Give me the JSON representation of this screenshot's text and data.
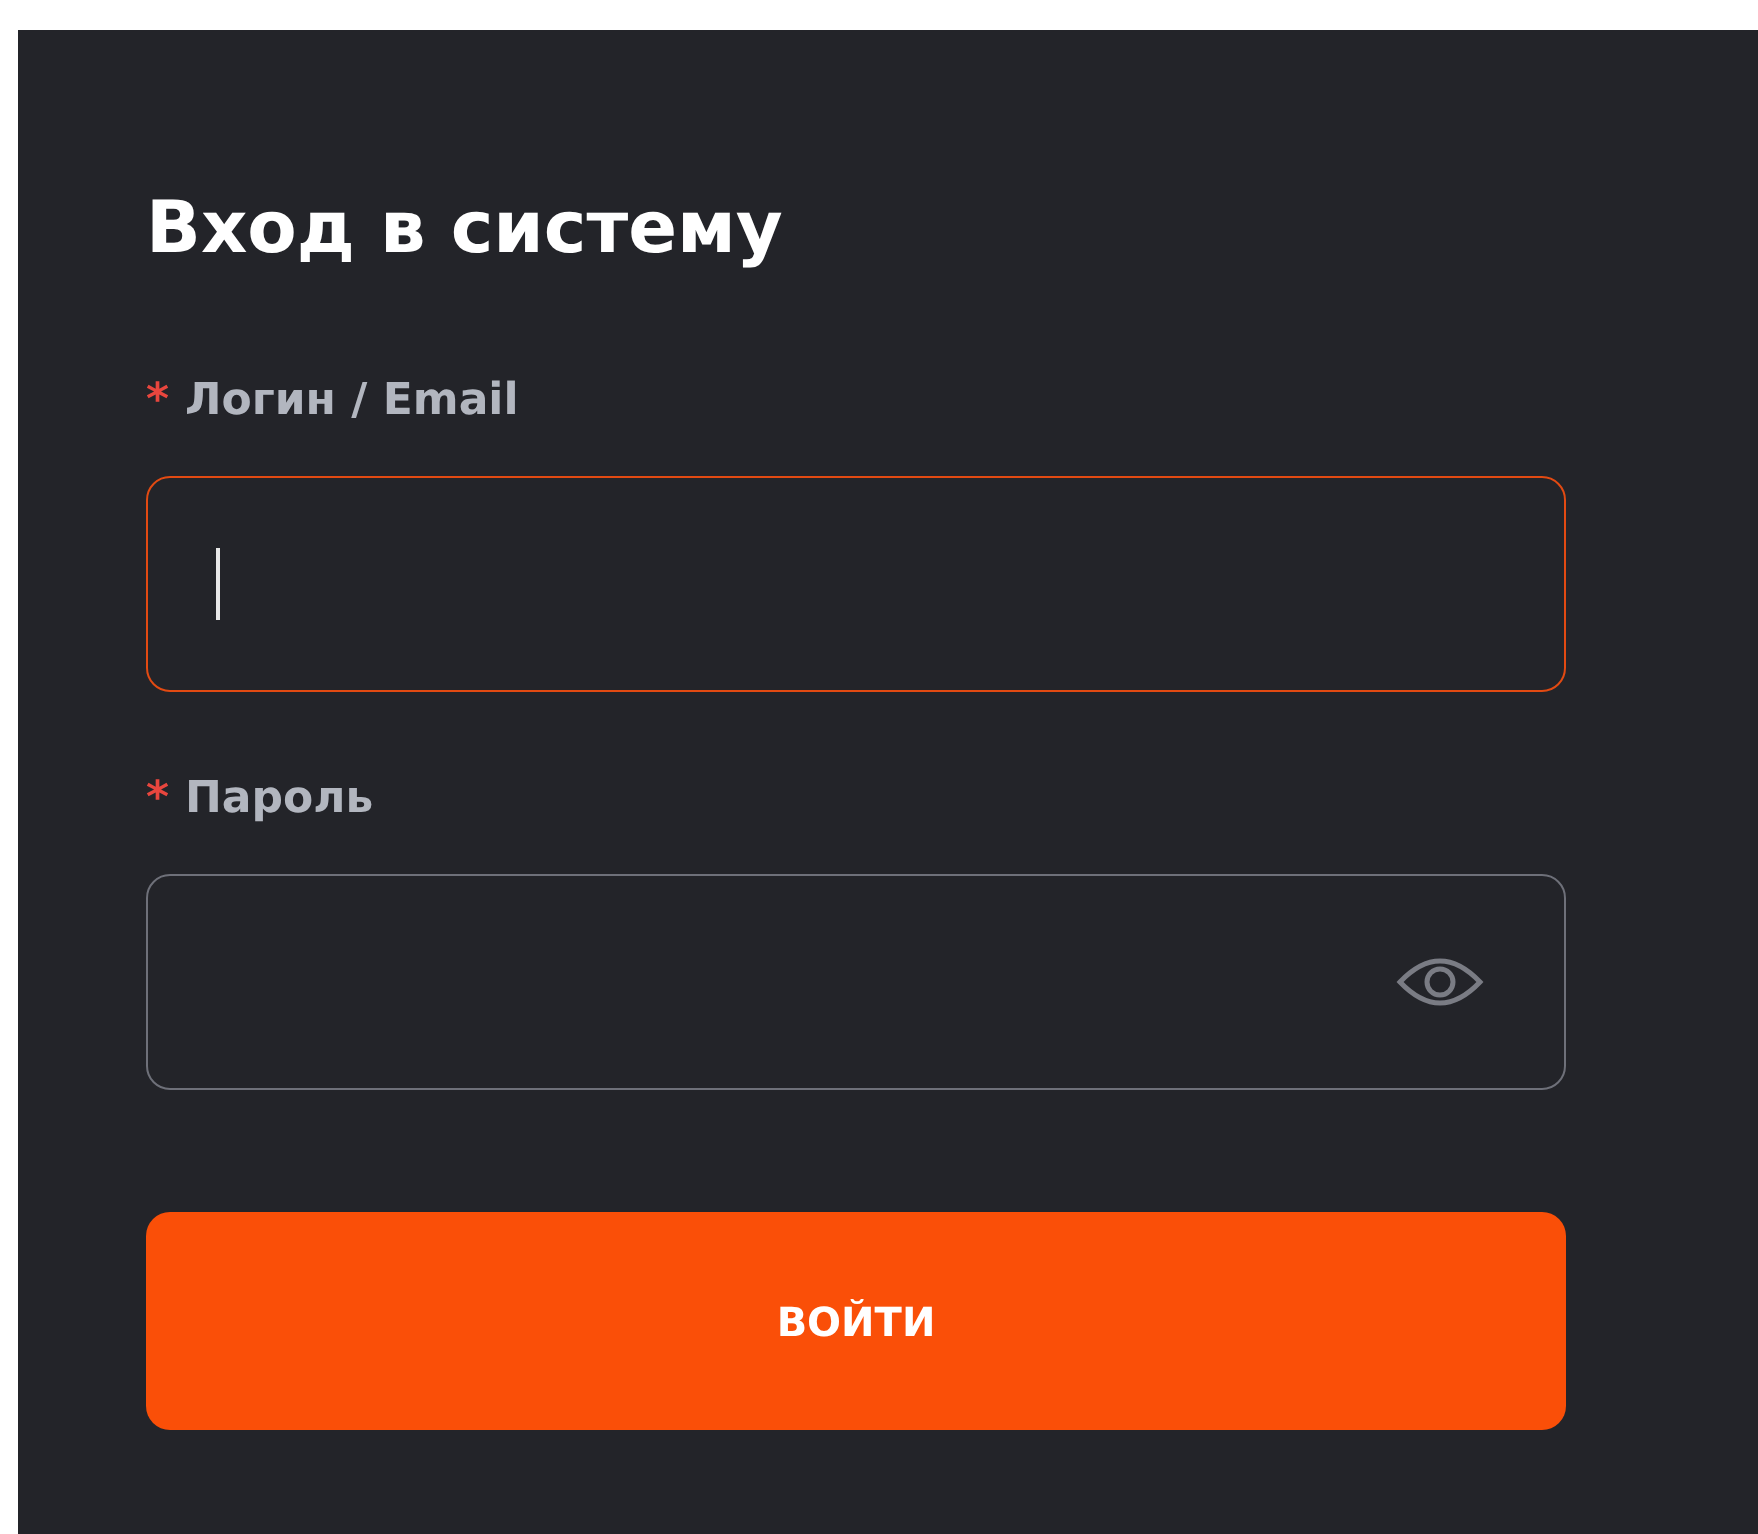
{
  "title": "Вход в систему",
  "fields": [
    {
      "required_mark": "*",
      "label": "Логин / Email",
      "kind": "text",
      "focused": true
    },
    {
      "required_mark": "*",
      "label": "Пароль",
      "kind": "password",
      "focused": false
    }
  ],
  "submit": {
    "label": "ВОЙТИ"
  }
}
